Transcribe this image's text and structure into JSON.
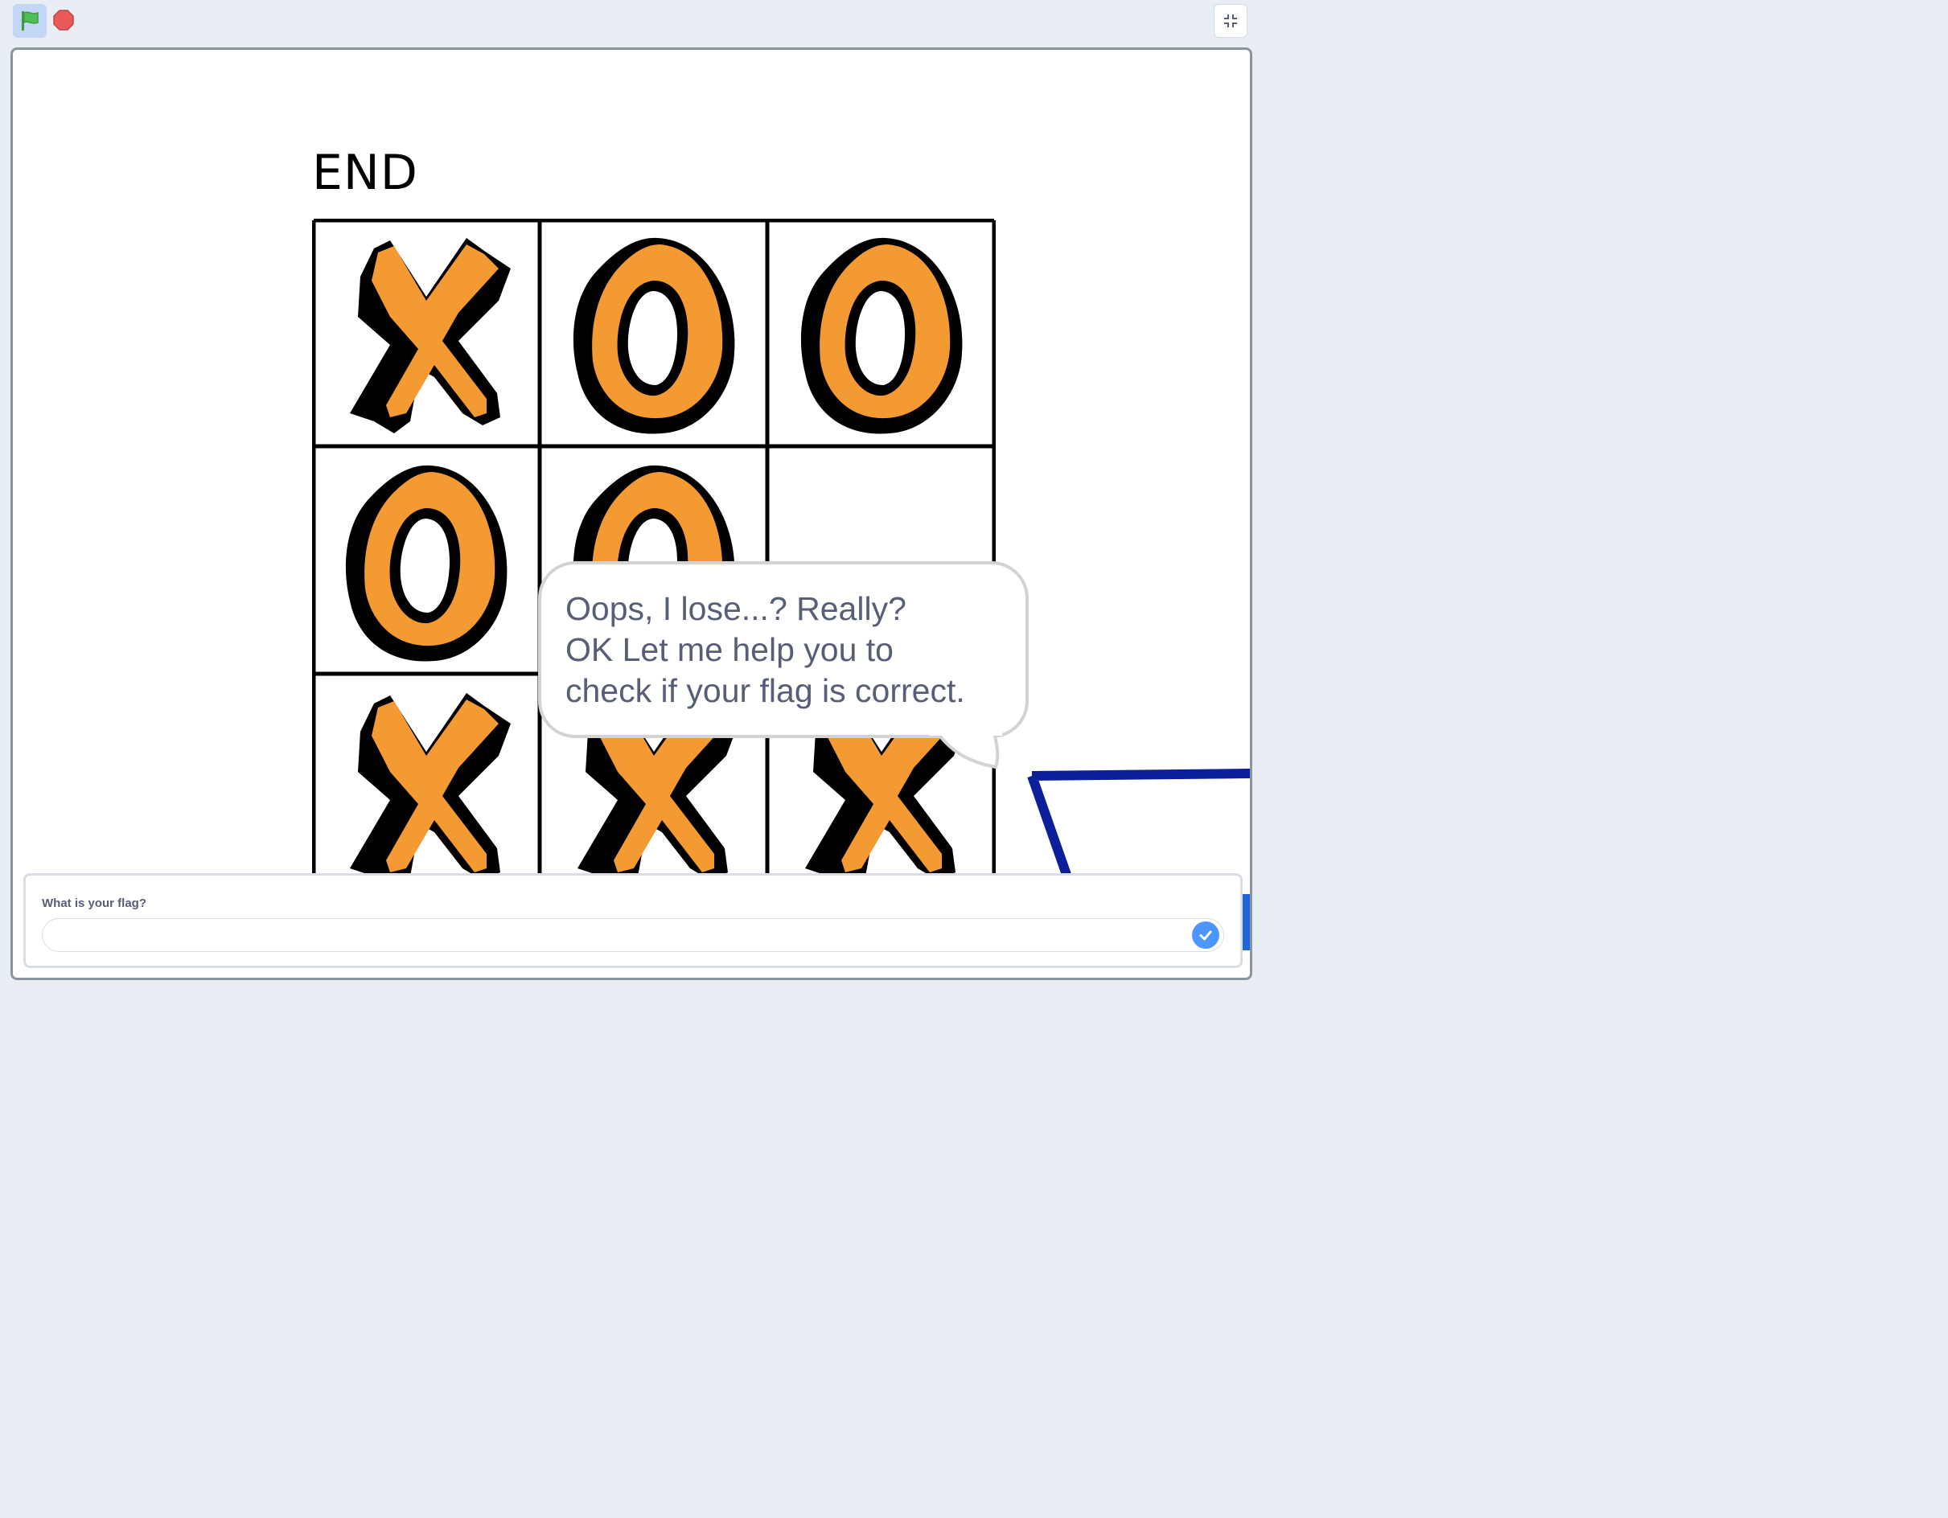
{
  "toolbar": {
    "green_flag_icon": "green-flag-icon",
    "stop_icon": "stop-icon",
    "fullscreen_icon": "exit-fullscreen-icon"
  },
  "stage": {
    "title": "END",
    "board": [
      [
        "X",
        "O",
        "O"
      ],
      [
        "O",
        "O",
        ""
      ],
      [
        "X",
        "X",
        "X"
      ]
    ],
    "mark_fill_color": "#f39a33",
    "mark_outline_color": "#000000"
  },
  "speech_bubble": {
    "line1": "Oops, I lose...? Really?",
    "line2": "OK Let me help you to",
    "line3": "check if your flag is correct."
  },
  "ask_prompt": {
    "question": "What is your flag?",
    "input_value": "",
    "submit_icon": "check-icon",
    "accent_color": "#4c97ff"
  }
}
